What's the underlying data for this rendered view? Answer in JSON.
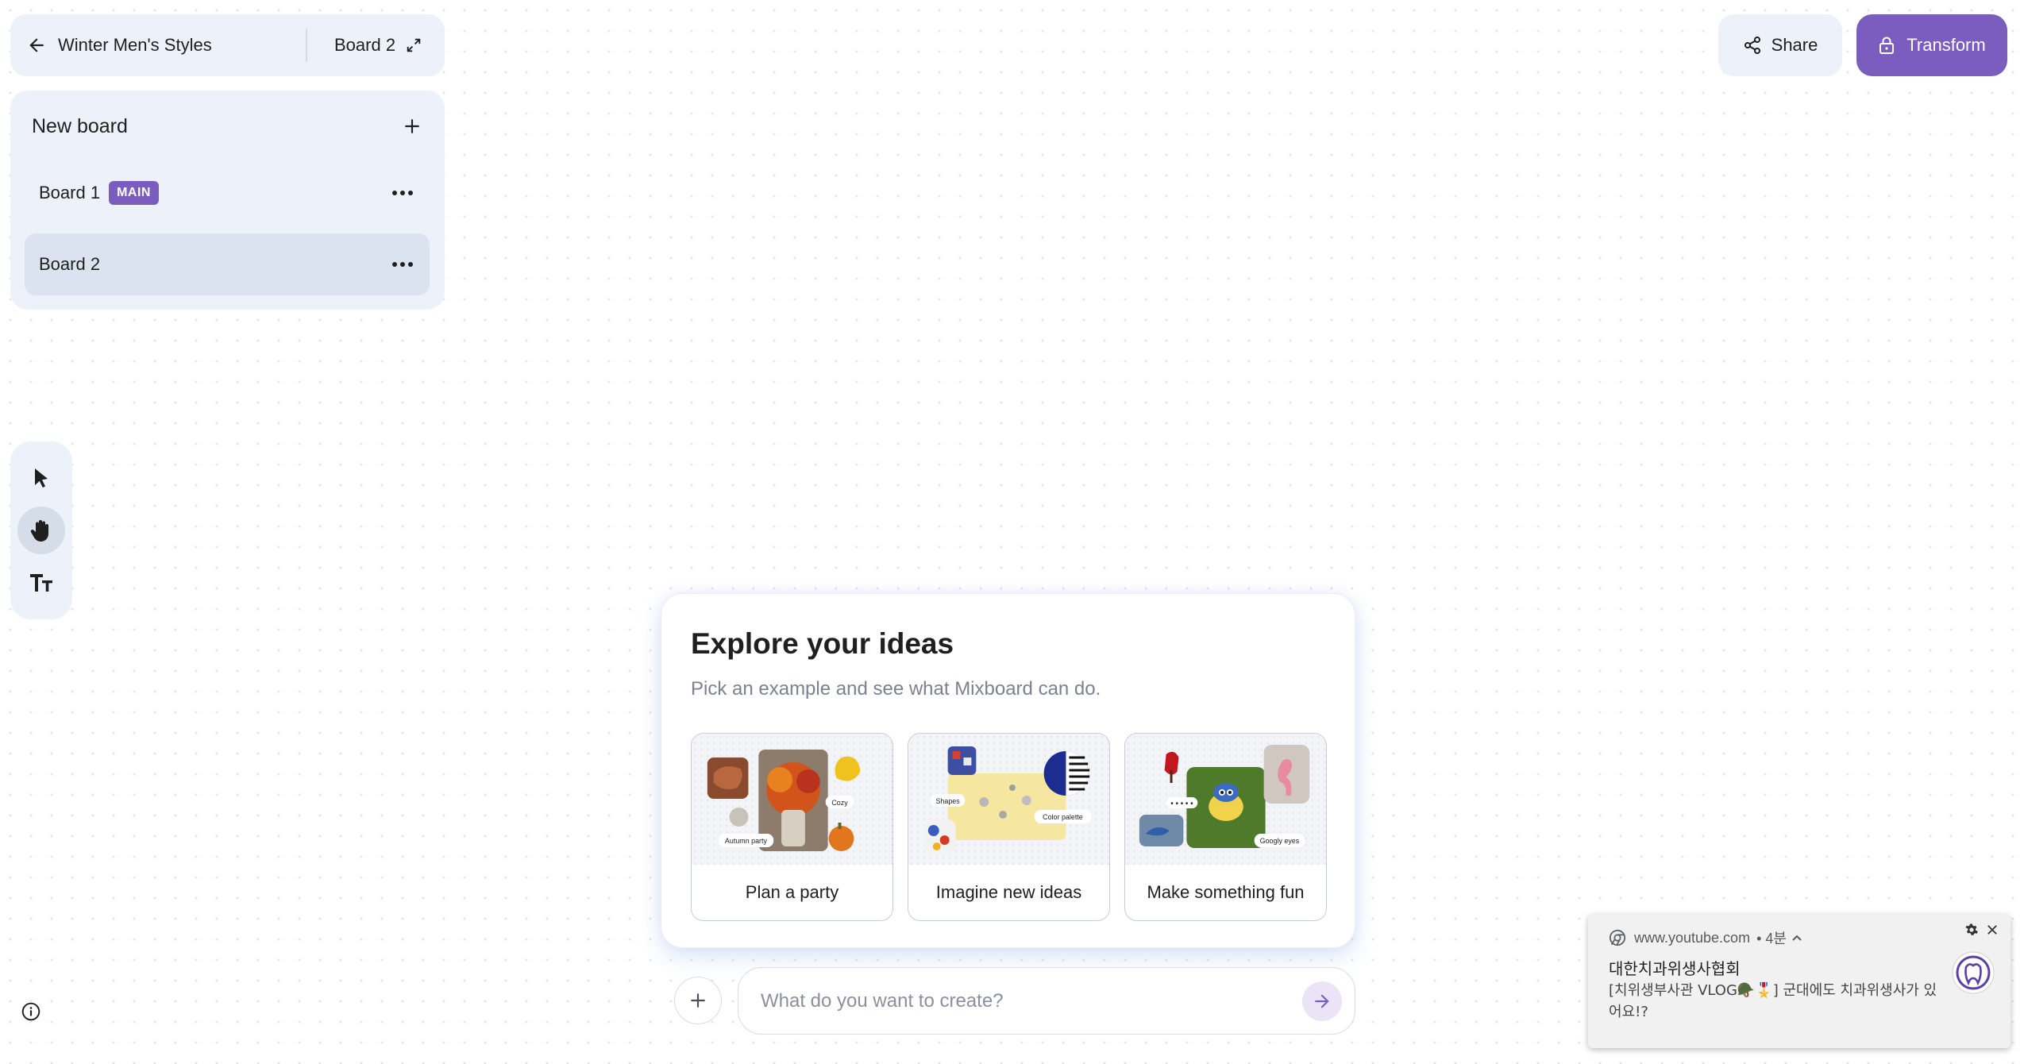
{
  "header": {
    "project_title": "Winter Men's Styles",
    "current_board": "Board 2"
  },
  "boards_panel": {
    "new_board_label": "New board",
    "boards": [
      {
        "name": "Board 1",
        "badge": "MAIN"
      },
      {
        "name": "Board 2",
        "selected": true
      }
    ]
  },
  "actions": {
    "share_label": "Share",
    "transform_label": "Transform"
  },
  "tools": [
    {
      "name": "select-tool",
      "icon": "cursor-arrow-icon"
    },
    {
      "name": "pan-tool",
      "icon": "hand-icon",
      "active": true
    },
    {
      "name": "text-tool",
      "icon": "text-size-icon"
    }
  ],
  "explore": {
    "title": "Explore your ideas",
    "subtitle": "Pick an example and see what Mixboard can do.",
    "examples": [
      {
        "label": "Plan a party",
        "tags": [
          "Cozy",
          "Autumn party"
        ]
      },
      {
        "label": "Imagine new ideas",
        "tags": [
          "Shapes",
          "Color palette"
        ]
      },
      {
        "label": "Make something fun",
        "tags": [
          "Googly eyes"
        ]
      }
    ]
  },
  "prompt": {
    "placeholder": "What do you want to create?"
  },
  "notification": {
    "site": "www.youtube.com",
    "time": "• 4분",
    "title": "대한치과위생사협회",
    "body": "[치위생부사관 VLOG🪖🎖️] 군대에도 치과위생사가 있어요!?"
  },
  "colors": {
    "accent": "#7b5cbf",
    "panel_bg": "#edf1f9",
    "selected_bg": "#dbe3f0"
  }
}
